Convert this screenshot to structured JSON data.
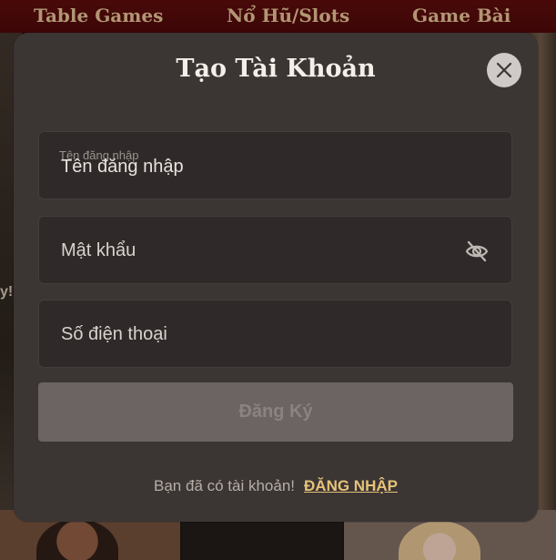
{
  "nav": {
    "items": [
      {
        "label": "Table Games"
      },
      {
        "label": "Nổ Hũ/Slots"
      },
      {
        "label": "Game Bài"
      }
    ]
  },
  "background": {
    "left_text": "y!"
  },
  "modal": {
    "title": "Tạo Tài Khoản",
    "close_icon": "close-icon",
    "fields": {
      "username": {
        "label": "Tên đăng nhập",
        "value": "Tên đăng nhập"
      },
      "password": {
        "placeholder": "Mật khẩu",
        "icon": "eye-off-icon"
      },
      "phone": {
        "placeholder": "Số điện thoại"
      }
    },
    "register_label": "Đăng Ký",
    "footer": {
      "prompt": "Bạn đã có tài khoản!",
      "login_label": "ĐĂNG NHẬP"
    }
  },
  "colors": {
    "modal_bg": "#3b3534",
    "field_bg": "#2f2a29",
    "button_disabled": "#6b6463",
    "link_accent": "#e6c27a",
    "nav_bg": "#5a0c0c",
    "nav_text": "#d8b88e"
  }
}
